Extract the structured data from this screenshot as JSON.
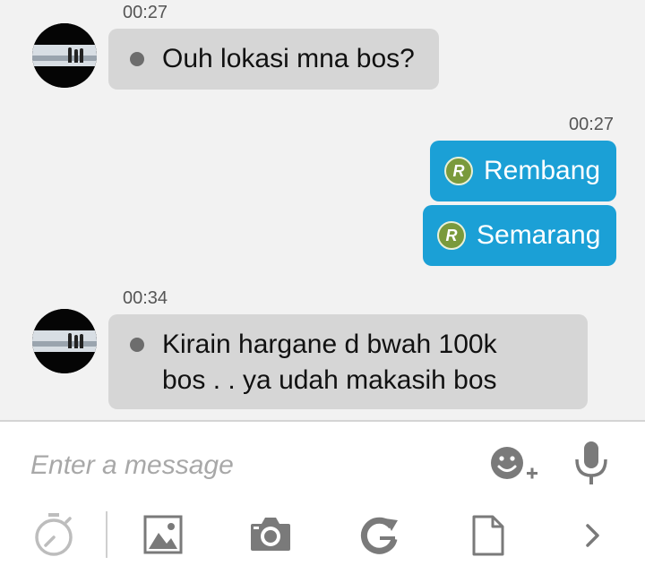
{
  "messages": [
    {
      "time": "00:27",
      "direction": "in",
      "text": "Ouh lokasi mna bos?"
    },
    {
      "time": "00:27",
      "direction": "out",
      "badge": "R",
      "text": "Rembang"
    },
    {
      "direction": "out",
      "badge": "R",
      "text": "Semarang"
    },
    {
      "time": "00:34",
      "direction": "in",
      "text_line1": "Kirain hargane d bwah 100k",
      "text_line2": "bos . . ya udah makasih bos"
    }
  ],
  "composer": {
    "placeholder": "Enter a message",
    "icons": [
      "emoji-add-icon",
      "microphone-icon"
    ]
  },
  "toolbar": {
    "icons": [
      "timer-icon",
      "image-icon",
      "camera-icon",
      "refresh-g-icon",
      "file-icon",
      "chevron-right-icon"
    ]
  },
  "colors": {
    "outgoing_bubble": "#1ba0d6",
    "incoming_bubble": "#d6d6d6",
    "badge": "#7a9a3c",
    "background": "#f2f2f2"
  }
}
